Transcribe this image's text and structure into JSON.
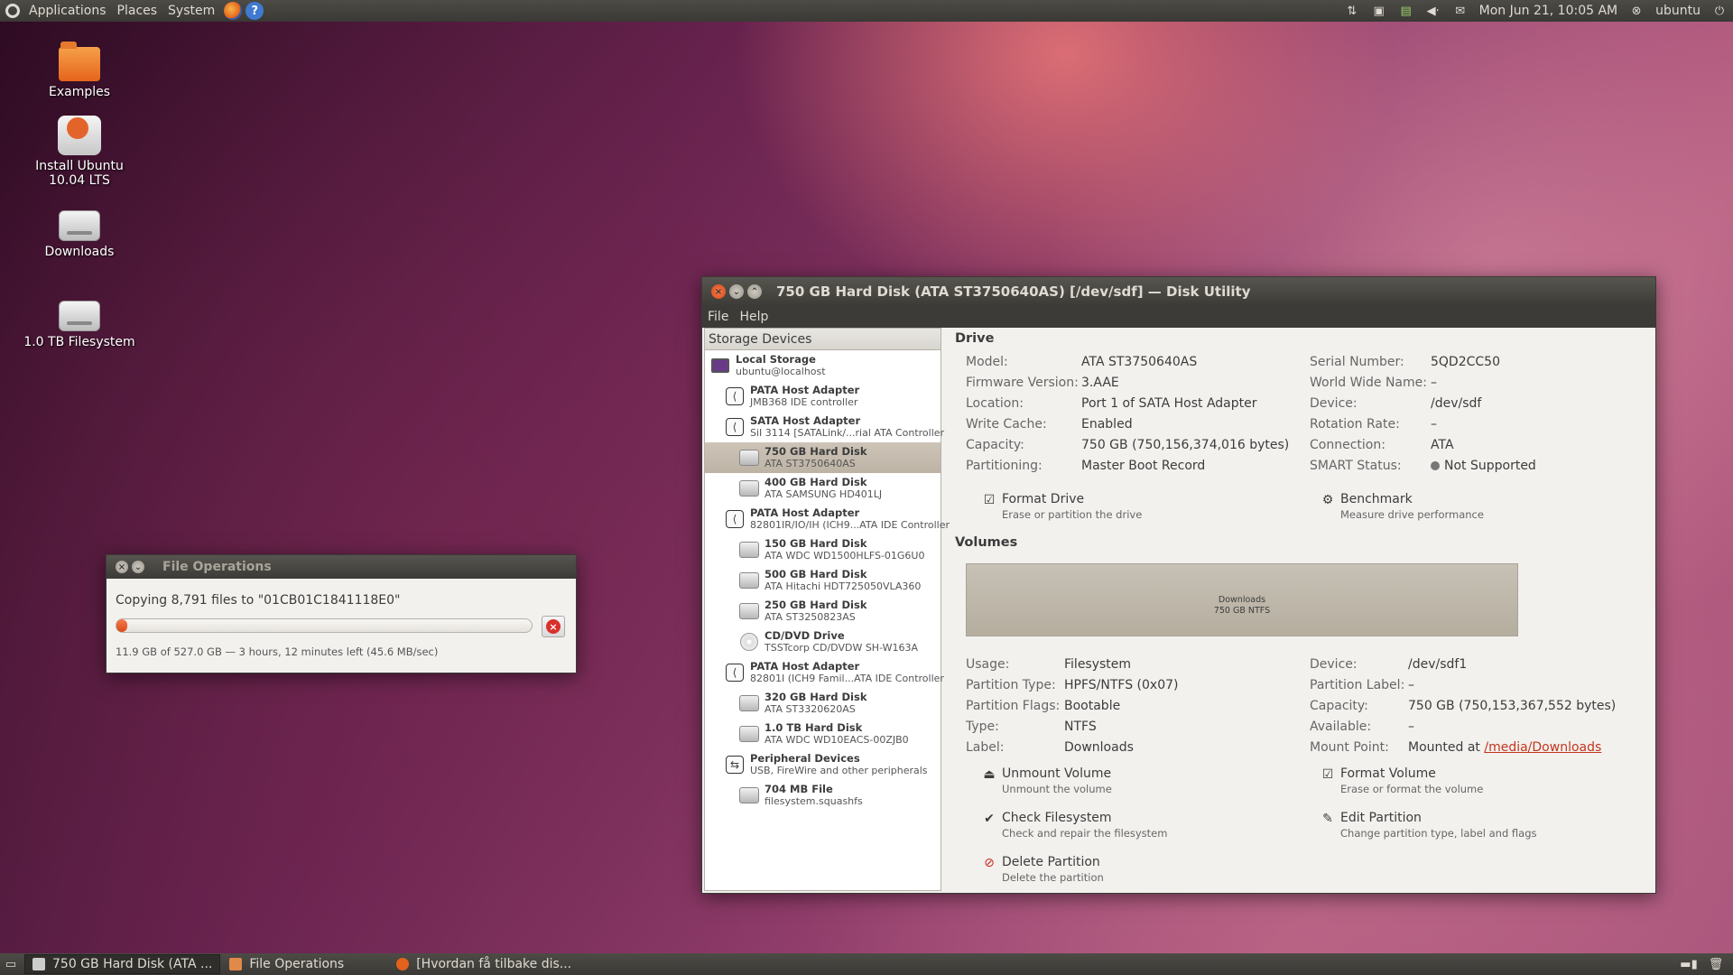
{
  "top_panel": {
    "menus": [
      "Applications",
      "Places",
      "System"
    ],
    "clock": "Mon Jun 21, 10:05 AM",
    "user": "ubuntu",
    "icons": [
      "ubuntu-logo-icon",
      "firefox-icon",
      "help-icon",
      "network-icon",
      "display-icon",
      "update-icon",
      "volume-icon",
      "mail-icon",
      "user-icon",
      "power-icon"
    ]
  },
  "desktop": {
    "icons": [
      {
        "label": "Examples",
        "icon": "folder-icon"
      },
      {
        "label": "Install Ubuntu 10.04 LTS",
        "icon": "installer-icon"
      },
      {
        "label": "Downloads",
        "icon": "drive-icon"
      },
      {
        "label": "1.0 TB Filesystem",
        "icon": "drive-icon"
      }
    ]
  },
  "disk_utility": {
    "title": "750 GB Hard Disk (ATA ST3750640AS) [/dev/sdf] — Disk Utility",
    "menu": [
      "File",
      "Help"
    ],
    "storage_header": "Storage Devices",
    "devices": [
      {
        "name": "Local Storage",
        "sub": "ubuntu@localhost",
        "icon": "computer-icon",
        "level": 0
      },
      {
        "name": "PATA Host Adapter",
        "sub": "JMB368 IDE controller",
        "icon": "host-adapter-icon",
        "level": 1
      },
      {
        "name": "SATA Host Adapter",
        "sub": "SiI 3114 [SATALink/...rial ATA Controller",
        "icon": "host-adapter-icon",
        "level": 1
      },
      {
        "name": "750 GB Hard Disk",
        "sub": "ATA ST3750640AS",
        "icon": "hard-disk-icon",
        "level": 2,
        "selected": true
      },
      {
        "name": "400 GB Hard Disk",
        "sub": "ATA SAMSUNG HD401LJ",
        "icon": "hard-disk-icon",
        "level": 2
      },
      {
        "name": "PATA Host Adapter",
        "sub": "82801IR/IO/IH (ICH9...ATA IDE Controller",
        "icon": "host-adapter-icon",
        "level": 1
      },
      {
        "name": "150 GB Hard Disk",
        "sub": "ATA WDC WD1500HLFS-01G6U0",
        "icon": "hard-disk-icon",
        "level": 2
      },
      {
        "name": "500 GB Hard Disk",
        "sub": "ATA Hitachi HDT725050VLA360",
        "icon": "hard-disk-icon",
        "level": 2
      },
      {
        "name": "250 GB Hard Disk",
        "sub": "ATA ST3250823AS",
        "icon": "hard-disk-icon",
        "level": 2
      },
      {
        "name": "CD/DVD Drive",
        "sub": "TSSTcorp CD/DVDW SH-W163A",
        "icon": "optical-drive-icon",
        "level": 2
      },
      {
        "name": "PATA Host Adapter",
        "sub": "82801I (ICH9 Famil...ATA IDE Controller",
        "icon": "host-adapter-icon",
        "level": 1
      },
      {
        "name": "320 GB Hard Disk",
        "sub": "ATA ST3320620AS",
        "icon": "hard-disk-icon",
        "level": 2
      },
      {
        "name": "1.0 TB Hard Disk",
        "sub": "ATA WDC WD10EACS-00ZJB0",
        "icon": "hard-disk-icon",
        "level": 2
      },
      {
        "name": "Peripheral Devices",
        "sub": "USB, FireWire and other peripherals",
        "icon": "usb-icon",
        "level": 1
      },
      {
        "name": "704 MB File",
        "sub": "filesystem.squashfs",
        "icon": "file-disk-icon",
        "level": 2
      }
    ],
    "drive": {
      "header": "Drive",
      "left": [
        {
          "k": "Model:",
          "v": "ATA ST3750640AS"
        },
        {
          "k": "Firmware Version:",
          "v": "3.AAE"
        },
        {
          "k": "Location:",
          "v": "Port 1 of SATA Host Adapter"
        },
        {
          "k": "Write Cache:",
          "v": "Enabled"
        },
        {
          "k": "Capacity:",
          "v": "750 GB (750,156,374,016 bytes)"
        },
        {
          "k": "Partitioning:",
          "v": "Master Boot Record"
        }
      ],
      "right": [
        {
          "k": "Serial Number:",
          "v": "5QD2CC50"
        },
        {
          "k": "World Wide Name:",
          "v": "–"
        },
        {
          "k": "Device:",
          "v": "/dev/sdf"
        },
        {
          "k": "Rotation Rate:",
          "v": "–"
        },
        {
          "k": "Connection:",
          "v": "ATA"
        },
        {
          "k": "SMART Status:",
          "v": "Not Supported"
        }
      ],
      "actions": [
        {
          "label": "Format Drive",
          "sub": "Erase or partition the drive"
        },
        {
          "label": "Benchmark",
          "sub": "Measure drive performance"
        }
      ]
    },
    "volumes": {
      "header": "Volumes",
      "bar_name": "Downloads",
      "bar_size": "750 GB NTFS",
      "left": [
        {
          "k": "Usage:",
          "v": "Filesystem"
        },
        {
          "k": "Partition Type:",
          "v": "HPFS/NTFS (0x07)"
        },
        {
          "k": "Partition Flags:",
          "v": "Bootable"
        },
        {
          "k": "Type:",
          "v": "NTFS"
        },
        {
          "k": "Label:",
          "v": "Downloads"
        }
      ],
      "right": [
        {
          "k": "Device:",
          "v": "/dev/sdf1"
        },
        {
          "k": "Partition Label:",
          "v": "–"
        },
        {
          "k": "Capacity:",
          "v": "750 GB (750,153,367,552 bytes)"
        },
        {
          "k": "Available:",
          "v": "–"
        },
        {
          "k": "Mount Point:",
          "v": "Mounted at ",
          "link": "/media/Downloads"
        }
      ],
      "actions": [
        {
          "label": "Unmount Volume",
          "sub": "Unmount the volume"
        },
        {
          "label": "Format Volume",
          "sub": "Erase or format the volume"
        },
        {
          "label": "Check Filesystem",
          "sub": "Check and repair the filesystem"
        },
        {
          "label": "Edit Partition",
          "sub": "Change partition type, label and flags"
        },
        {
          "label": "Delete Partition",
          "sub": "Delete the partition"
        }
      ]
    }
  },
  "file_operations": {
    "title": "File Operations",
    "message": "Copying 8,791 files to \"01CB01C1841118E0\"",
    "progress_fraction": 0.0226,
    "details": "11.9 GB of 527.0 GB — 3 hours, 12 minutes left (45.6 MB/sec)"
  },
  "bottom_panel": {
    "tasks": [
      {
        "label": "750 GB Hard Disk (ATA ...",
        "active": true
      },
      {
        "label": "File Operations",
        "active": false
      },
      {
        "label": "[Hvordan få tilbake dis...",
        "active": false
      }
    ]
  },
  "colors": {
    "accent": "#d94a1a",
    "panel": "#3c3b37",
    "link": "#c5341e"
  }
}
